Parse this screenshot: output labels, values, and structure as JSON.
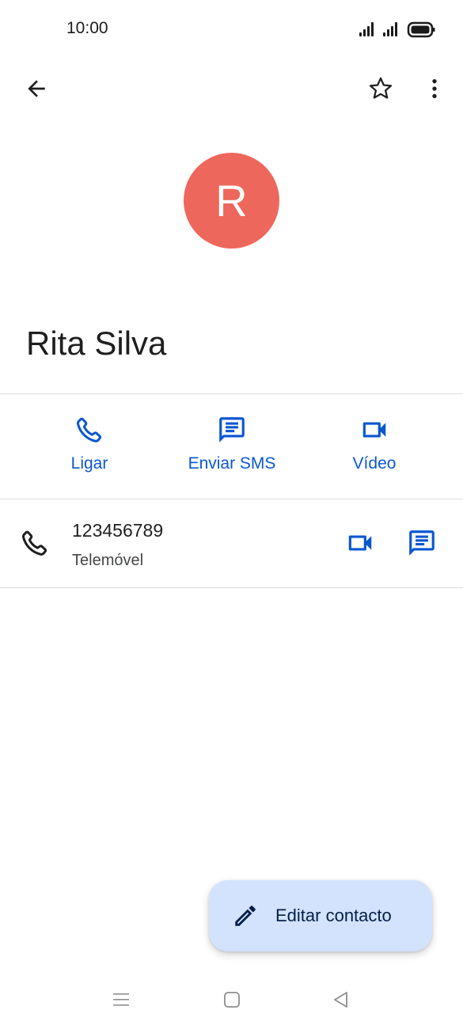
{
  "status_bar": {
    "time": "10:00"
  },
  "top_bar": {
    "back_icon": "arrow-back-icon",
    "star_icon": "star-outline-icon",
    "more_icon": "more-vert-icon"
  },
  "contact": {
    "avatar_letter": "R",
    "avatar_color": "#ee675c",
    "name": "Rita Silva"
  },
  "actions": [
    {
      "label": "Ligar",
      "icon": "phone-icon"
    },
    {
      "label": "Enviar SMS",
      "icon": "message-icon"
    },
    {
      "label": "Vídeo",
      "icon": "videocam-icon"
    }
  ],
  "phone": {
    "number": "123456789",
    "type": "Telemóvel"
  },
  "fab": {
    "label": "Editar contacto",
    "icon": "pencil-icon"
  },
  "colors": {
    "accent": "#0b57d0",
    "fab_background": "#d3e3fd",
    "divider": "#dadce0"
  },
  "nav_bar": {
    "menu_icon": "menu-icon",
    "home_icon": "home-square-icon",
    "back_icon": "back-triangle-icon"
  }
}
